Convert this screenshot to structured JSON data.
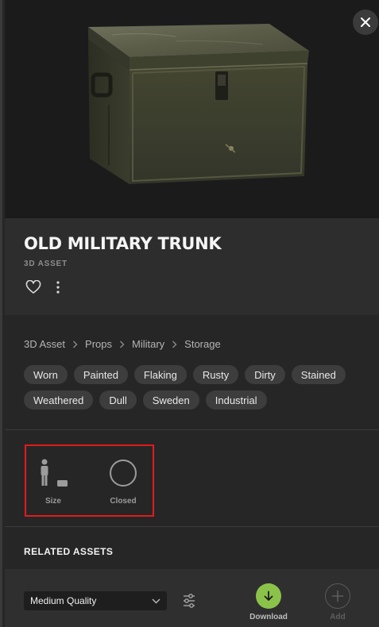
{
  "asset": {
    "title": "OLD MILITARY TRUNK",
    "type_label": "3D ASSET"
  },
  "breadcrumb": [
    "3D Asset",
    "Props",
    "Military",
    "Storage"
  ],
  "tags": [
    "Worn",
    "Painted",
    "Flaking",
    "Rusty",
    "Dirty",
    "Stained",
    "Weathered",
    "Dull",
    "Sweden",
    "Industrial"
  ],
  "specs": {
    "size_label": "Size",
    "closed_label": "Closed"
  },
  "related": {
    "title": "RELATED ASSETS"
  },
  "footer": {
    "quality_value": "Medium Quality",
    "download_label": "Download",
    "add_label": "Add"
  },
  "icons": {
    "close": "close-icon",
    "heart": "heart-icon",
    "more": "more-vertical-icon",
    "breadcrumb_separator": "chevron-right-icon",
    "size": "person-scale-icon",
    "closed": "circle-outline-icon",
    "dropdown": "chevron-down-icon",
    "filter": "sliders-icon",
    "download": "arrow-down-icon",
    "add": "plus-icon"
  },
  "colors": {
    "accent_download": "#8bc34a",
    "highlight_border": "#e01b1b",
    "panel_bg": "#262626"
  }
}
